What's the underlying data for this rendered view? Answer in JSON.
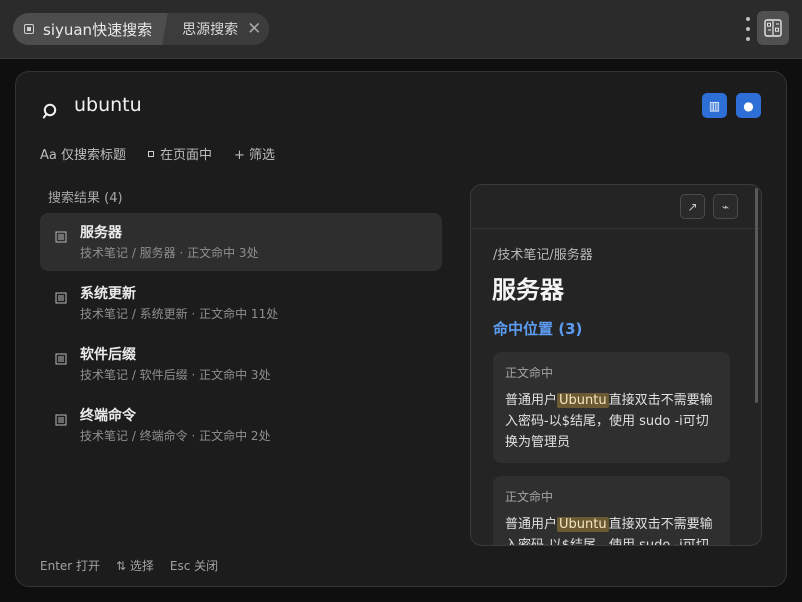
{
  "titlebar": {
    "tab_app": "siyuan快速搜索",
    "tab_search": "思源搜索"
  },
  "search": {
    "query": "ubuntu"
  },
  "options": {
    "title_only": "Aa 仅搜索标题",
    "in_page": "在页面中",
    "filter": "+ 筛选"
  },
  "results": {
    "header": "搜索结果 (4)",
    "items": [
      {
        "title": "服务器",
        "path": "技术笔记 / 服务器 · 正文命中 3处"
      },
      {
        "title": "系统更新",
        "path": "技术笔记 / 系统更新 · 正文命中 11处"
      },
      {
        "title": "软件后缀",
        "path": "技术笔记 / 软件后缀 · 正文命中 3处"
      },
      {
        "title": "终端命令",
        "path": "技术笔记 / 终端命令 · 正文命中 2处"
      }
    ]
  },
  "preview": {
    "path": "/技术笔记/服务器",
    "title": "服务器",
    "hits_label": "命中位置 (3)",
    "hits": [
      {
        "label": "正文命中",
        "pre": "普通用户",
        "highlight": "Ubuntu",
        "post": "直接双击不需要输入密码-以$结尾，使用 sudo -i可切换为管理员"
      },
      {
        "label": "正文命中",
        "pre": "普通用户",
        "highlight": "Ubuntu",
        "post": "直接双击不需要输入密码-以$结尾，使用 sudo -i可切"
      }
    ]
  },
  "footer": {
    "enter": "Enter 打开",
    "select": "⇅ 选择",
    "esc": "Esc 关闭"
  },
  "colors": {
    "accent": "#2d6fd6",
    "hit_title": "#5c9df3",
    "highlight_bg": "#6b5a32"
  }
}
